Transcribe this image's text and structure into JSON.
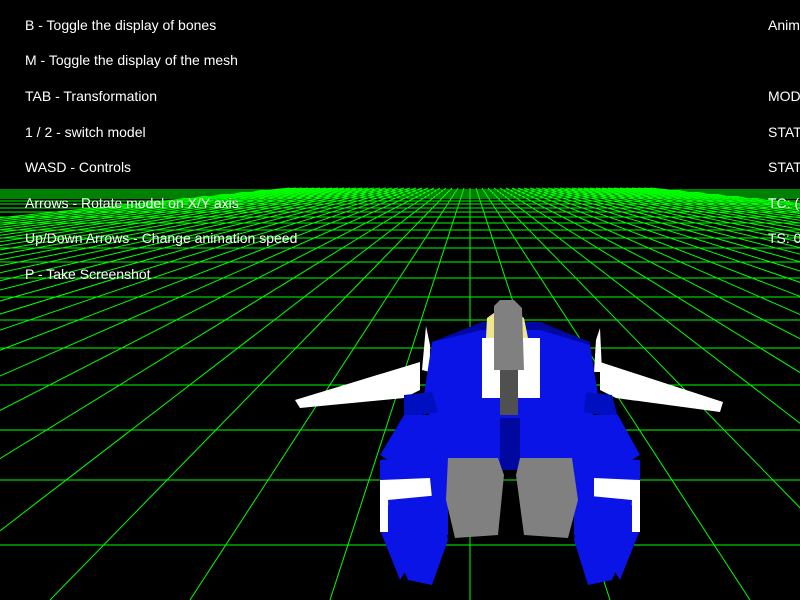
{
  "hud": {
    "controls": [
      "B - Toggle the display of bones",
      "M - Toggle the display of the mesh",
      "TAB - Transformation",
      "1 / 2 - switch model",
      "WASD - Controls",
      "Arrows - Rotate model on X/Y axis",
      "Up/Down Arrows - Change animation speed",
      "P - Take Screenshot"
    ],
    "status_partial": [
      "Anim",
      "MOD",
      "STAT",
      "STAT",
      "TC: (",
      "TS: 0"
    ]
  },
  "colors": {
    "background": "#000000",
    "grid": "#00ff00",
    "hud_text": "#ffffff",
    "mech_blue": "#0a14e6",
    "mech_dark_blue": "#0008a0",
    "mech_white": "#ffffff",
    "mech_gray": "#808080",
    "mech_yellow": "#f0e68c"
  },
  "scene": {
    "floor": "wireframe-grid",
    "model": "blue-white-mech-robot"
  }
}
